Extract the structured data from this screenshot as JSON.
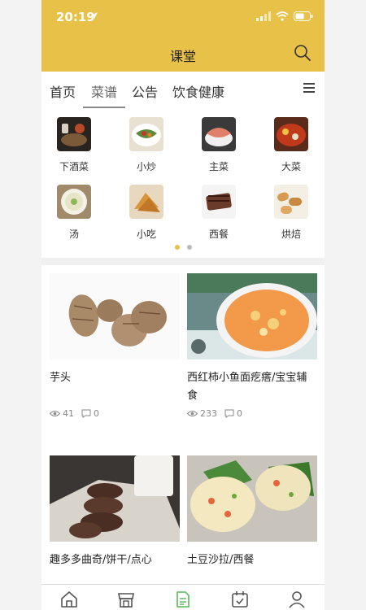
{
  "status": {
    "time": "20:19"
  },
  "header": {
    "title": "课堂"
  },
  "tabs": [
    {
      "label": "首页"
    },
    {
      "label": "菜谱"
    },
    {
      "label": "公告"
    },
    {
      "label": "饮食健康"
    }
  ],
  "categories": [
    {
      "label": "下酒菜"
    },
    {
      "label": "小炒"
    },
    {
      "label": "主菜"
    },
    {
      "label": "大菜"
    },
    {
      "label": "汤"
    },
    {
      "label": "小吃"
    },
    {
      "label": "西餐"
    },
    {
      "label": "烘焙"
    }
  ],
  "pager": {
    "pages": 2,
    "active": 1
  },
  "cards": [
    {
      "title": "芋头",
      "views": "41",
      "comments": "0"
    },
    {
      "title": "西红柿小鱼面疙瘩/宝宝辅食",
      "views": "233",
      "comments": "0"
    },
    {
      "title": "趣多多曲奇/饼干/点心"
    },
    {
      "title": "土豆沙拉/西餐"
    }
  ],
  "tabbar": [
    "home-icon",
    "shop-icon",
    "recipe-icon",
    "calendar-icon",
    "profile-icon"
  ],
  "colors": {
    "accent": "#e8c148",
    "active_tab": "#6cc070"
  }
}
